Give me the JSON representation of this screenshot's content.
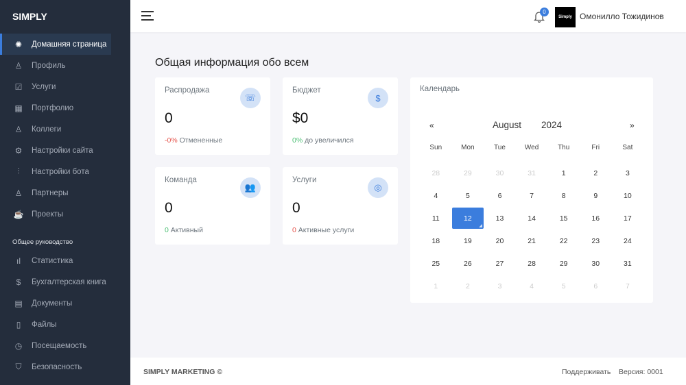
{
  "sidebar": {
    "logo": "SIMPLY",
    "items": [
      {
        "label": "Домашняя страница",
        "icon": "✺"
      },
      {
        "label": "Профиль",
        "icon": "♙"
      },
      {
        "label": "Услуги",
        "icon": "☑"
      },
      {
        "label": "Портфолио",
        "icon": "▦"
      },
      {
        "label": "Коллеги",
        "icon": "♙"
      },
      {
        "label": "Настройки сайта",
        "icon": "⚙"
      },
      {
        "label": "Настройки бота",
        "icon": "⫶"
      },
      {
        "label": "Партнеры",
        "icon": "♙"
      },
      {
        "label": "Проекты",
        "icon": "☕"
      }
    ],
    "section": "Общее руководство",
    "items2": [
      {
        "label": "Статистика",
        "icon": "ıl"
      },
      {
        "label": "Бухгалтерская книга",
        "icon": "$"
      },
      {
        "label": "Документы",
        "icon": "▤"
      },
      {
        "label": "Файлы",
        "icon": "▯"
      },
      {
        "label": "Посещаемость",
        "icon": "◷"
      },
      {
        "label": "Безопасность",
        "icon": "⛉"
      }
    ]
  },
  "header": {
    "notifications": "0",
    "avatar_text": "Simply",
    "user": "Омонилло Тожидинов"
  },
  "page": {
    "title": "Общая информация обо всем"
  },
  "cards": [
    {
      "label": "Распродажа",
      "value": "0",
      "delta": "-0%",
      "delta_color": "red",
      "note": "Отмененные",
      "icon": "☏"
    },
    {
      "label": "Бюджет",
      "value": "$0",
      "delta": "0%",
      "delta_color": "green",
      "note": "до увеличился",
      "icon": "$"
    },
    {
      "label": "Команда",
      "value": "0",
      "delta": "0",
      "delta_color": "green",
      "note": "Активный",
      "icon": "👥"
    },
    {
      "label": "Услуги",
      "value": "0",
      "delta": "0",
      "delta_color": "red",
      "note": "Активные услуги",
      "icon": "◎"
    }
  ],
  "calendar": {
    "label": "Календарь",
    "prev": "«",
    "next": "»",
    "month": "August",
    "year": "2024",
    "dows": [
      "Sun",
      "Mon",
      "Tue",
      "Wed",
      "Thu",
      "Fri",
      "Sat"
    ],
    "days": [
      [
        "28",
        "m"
      ],
      [
        "29",
        "m"
      ],
      [
        "30",
        "m"
      ],
      [
        "31",
        "m"
      ],
      [
        "1",
        ""
      ],
      [
        "2",
        ""
      ],
      [
        "3",
        ""
      ],
      [
        "4",
        ""
      ],
      [
        "5",
        ""
      ],
      [
        "6",
        ""
      ],
      [
        "7",
        ""
      ],
      [
        "8",
        ""
      ],
      [
        "9",
        ""
      ],
      [
        "10",
        ""
      ],
      [
        "11",
        ""
      ],
      [
        "12",
        "t"
      ],
      [
        "13",
        ""
      ],
      [
        "14",
        ""
      ],
      [
        "15",
        ""
      ],
      [
        "16",
        ""
      ],
      [
        "17",
        ""
      ],
      [
        "18",
        ""
      ],
      [
        "19",
        ""
      ],
      [
        "20",
        ""
      ],
      [
        "21",
        ""
      ],
      [
        "22",
        ""
      ],
      [
        "23",
        ""
      ],
      [
        "24",
        ""
      ],
      [
        "25",
        ""
      ],
      [
        "26",
        ""
      ],
      [
        "27",
        ""
      ],
      [
        "28",
        ""
      ],
      [
        "29",
        ""
      ],
      [
        "30",
        ""
      ],
      [
        "31",
        ""
      ],
      [
        "1",
        "m"
      ],
      [
        "2",
        "m"
      ],
      [
        "3",
        "m"
      ],
      [
        "4",
        "m"
      ],
      [
        "5",
        "m"
      ],
      [
        "6",
        "m"
      ],
      [
        "7",
        "m"
      ]
    ]
  },
  "footer": {
    "brand": "SIMPLY MARKETING ©",
    "support": "Поддерживать",
    "version": "Версия: 0001"
  }
}
